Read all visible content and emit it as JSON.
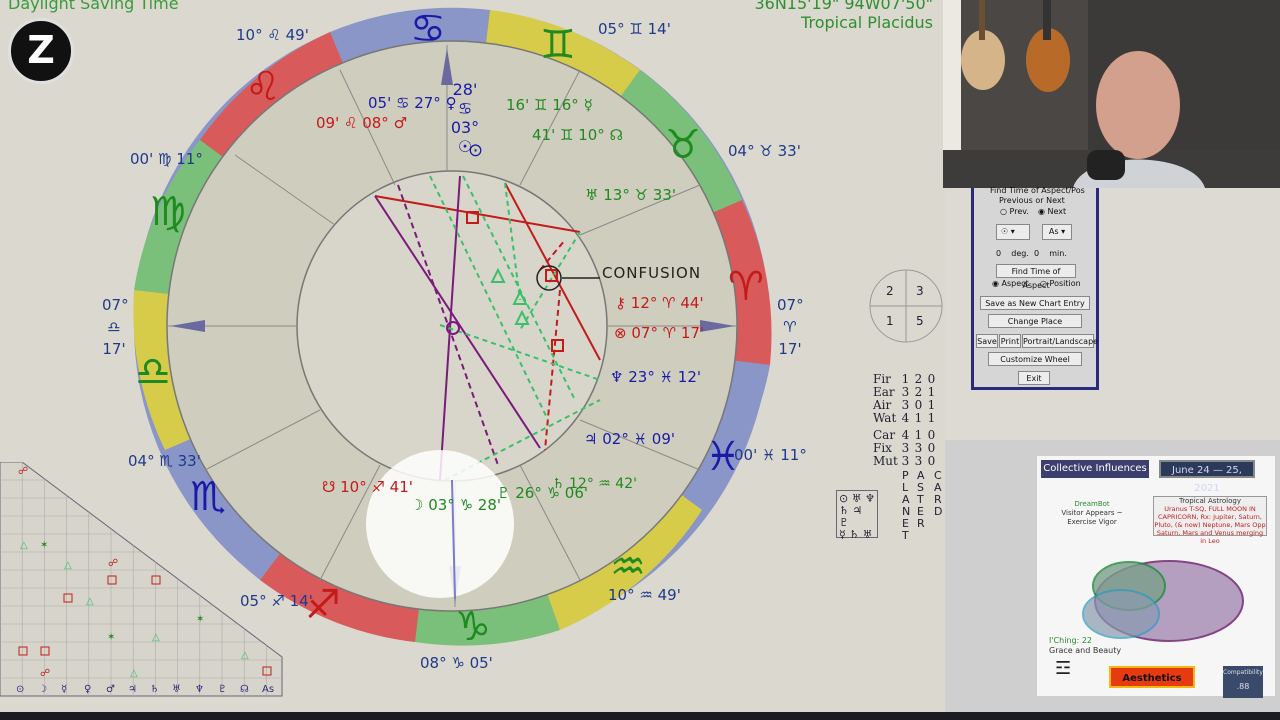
{
  "header": {
    "left_text": "Daylight Saving Time",
    "right_line1": "36N15'19\"  94W07'50\"",
    "right_line2": "Tropical Placidus"
  },
  "logo": {
    "symbol": "Z"
  },
  "wheel": {
    "asc_left": [
      "07°",
      "♎",
      "17'"
    ],
    "desc_right": [
      "07°",
      "♈",
      "17'"
    ],
    "mc_top": [
      "28'",
      "♋",
      "03°"
    ],
    "ic_bottom": "08° ♑ 05'",
    "outer_labels": [
      [
        "10°",
        "♌",
        "49'"
      ],
      [
        "05°",
        "♊",
        "14'"
      ],
      [
        "00'",
        "♍",
        "11°"
      ],
      [
        "04°",
        "♉",
        "33'"
      ],
      [
        "04°",
        "♏",
        "33'"
      ],
      [
        "00'",
        "♓",
        "11°"
      ],
      [
        "05°",
        "♐",
        "14'"
      ],
      [
        "10°",
        "♒",
        "49'"
      ]
    ],
    "planets": {
      "sun": "03° ♋ 28'",
      "venus": "05' ♋ 27°",
      "mars": "09' ♌ 08°",
      "mercury": "16' ♊ 16°",
      "node": "41' ♊ 10°",
      "uranus": "13° ♉ 33'",
      "chiron": "12° ♈ 44'",
      "pof": "07° ♈ 17'",
      "neptune": "23° ♓ 12'",
      "jupiter": "02° ♓ 09'",
      "saturn": "12° ♒ 42'",
      "pluto": "26° ♑ 06'",
      "moon": "03° ♑ 28'",
      "south_node": "10° ♐ 41'"
    },
    "annotation": "CONFUSION"
  },
  "houses": {
    "cells": [
      "2",
      "3",
      "1",
      "5"
    ]
  },
  "elements": {
    "rows": [
      {
        "name": "Fir",
        "a": "1",
        "b": "2",
        "c": "0"
      },
      {
        "name": "Ear",
        "a": "3",
        "b": "2",
        "c": "1"
      },
      {
        "name": "Air",
        "a": "3",
        "b": "0",
        "c": "1"
      },
      {
        "name": "Wat",
        "a": "4",
        "b": "1",
        "c": "1"
      },
      {
        "name": "Car",
        "a": "4",
        "b": "1",
        "c": "0"
      },
      {
        "name": "Fix",
        "a": "3",
        "b": "3",
        "c": "0"
      },
      {
        "name": "Mut",
        "a": "3",
        "b": "3",
        "c": "0"
      }
    ],
    "col_a": "PLANET",
    "col_b": "ASTER",
    "col_c": "CARD"
  },
  "panel": {
    "title": "Find Time of Aspect/Pos",
    "prev_next_label": "Previous or Next",
    "prev": "Prev.",
    "next": "Next",
    "planet_select": "☉",
    "aspect_select": "As",
    "deg_value": "0",
    "deg_label": "deg.",
    "min_value": "0",
    "min_label": "min.",
    "find_btn": "Find Time of Aspect",
    "aspect_radio": "Aspect",
    "position_radio": "Position",
    "save_new": "Save as New Chart Entry",
    "change_place": "Change Place",
    "save": "Save",
    "print": "Print",
    "portrait": "Portrait/Landscape",
    "customize": "Customize Wheel",
    "exit": "Exit"
  },
  "collective": {
    "title": "Collective Influences",
    "date": "June 24 — 25, 2021",
    "dream_title": "DreamBot",
    "dream_line1": "Visitor Appears ~",
    "dream_line2": "Exercise Vigor",
    "tropical_title": "Tropical Astrology",
    "tropical_text": "Uranus T-SQ, FULL MOON IN CAPRICORN, Rx: Jupiter, Saturn, Pluto, (& now) Neptune, Mars Opp Saturn, Mars and Venus merging in Leo",
    "iching_label": "I'Ching: 22",
    "iching_text": "Grace and Beauty",
    "aesthetics": "Aesthetics",
    "compat_label": "Compatibility",
    "compat_value": ".88"
  },
  "colors": {
    "background": "#dad8cf",
    "wheel_fill": "#cfcdbd",
    "zodiac_red": "#d85a5a",
    "zodiac_green": "#7ac07a",
    "zodiac_yellow": "#d6cc4a",
    "zodiac_blue": "#8a96c8",
    "glyph_red": "#c41a1a",
    "glyph_green": "#1f8a1f",
    "glyph_blue": "#1a1aa8"
  }
}
